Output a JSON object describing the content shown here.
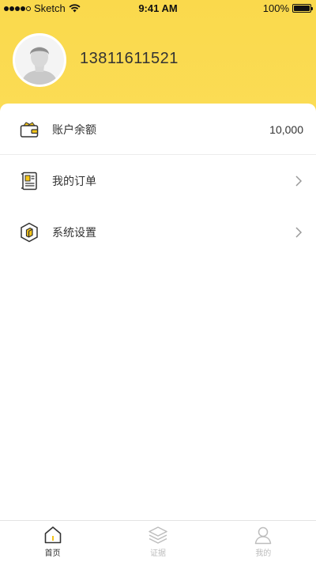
{
  "status_bar": {
    "carrier": "Sketch",
    "time": "9:41 AM",
    "battery": "100%"
  },
  "profile": {
    "phone": "13811611521"
  },
  "menu": {
    "balance": {
      "label": "账户余额",
      "value": "10,000",
      "icon": "wallet-icon"
    },
    "orders": {
      "label": "我的订单",
      "icon": "order-list-icon"
    },
    "settings": {
      "label": "系统设置",
      "icon": "settings-hexagon-icon"
    }
  },
  "tabs": [
    {
      "label": "首页",
      "icon": "home-icon",
      "active": true
    },
    {
      "label": "证据",
      "icon": "layers-icon",
      "active": false
    },
    {
      "label": "我的",
      "icon": "user-icon",
      "active": false
    }
  ],
  "colors": {
    "accent": "#fbdc55",
    "icon_yellow": "#f5c518",
    "inactive": "#bdbdbd"
  }
}
